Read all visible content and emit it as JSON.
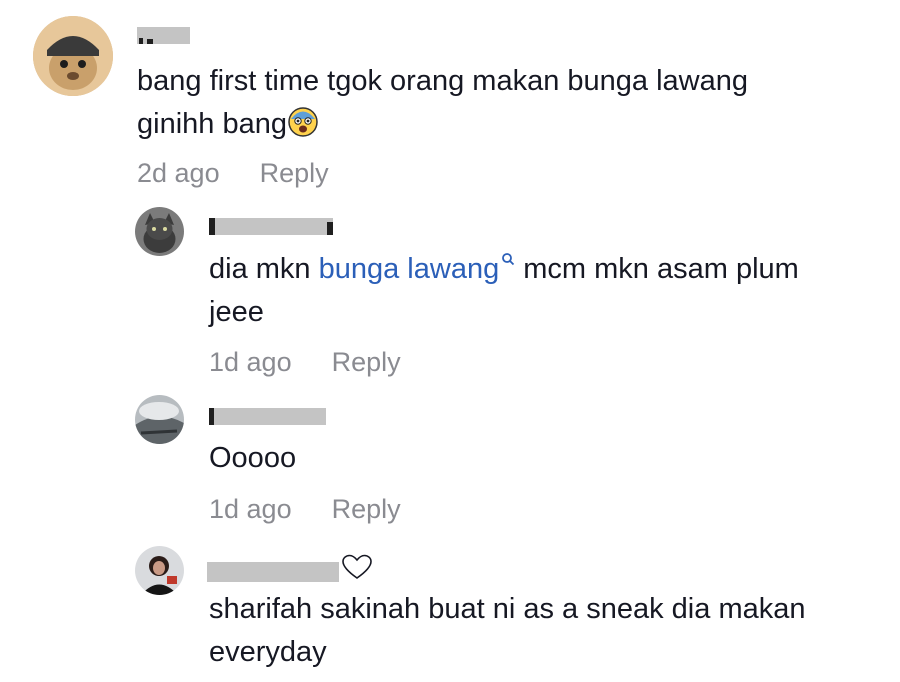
{
  "comments": [
    {
      "text_line1": "bang first time tgok orang makan bunga lawang",
      "text_line2": "ginihh bang",
      "emoji": "fearful-face-emoji",
      "time": "2d ago",
      "reply_label": "Reply"
    },
    {
      "text_before_link": "dia mkn ",
      "link_text": "bunga lawang",
      "text_after_link": " mcm mkn asam plum",
      "text_line2": "jeee",
      "time": "1d ago",
      "reply_label": "Reply"
    },
    {
      "text_line1": "Ooooo",
      "time": "1d ago",
      "reply_label": "Reply"
    },
    {
      "text_line1": "sharifah sakinah buat ni as a sneak dia makan",
      "text_line2": "everyday",
      "icon": "heart-outline-icon"
    }
  ],
  "colors": {
    "text": "#161823",
    "meta": "#8a8b91",
    "link": "#2b5fb8",
    "redaction": "#c4c4c4"
  }
}
